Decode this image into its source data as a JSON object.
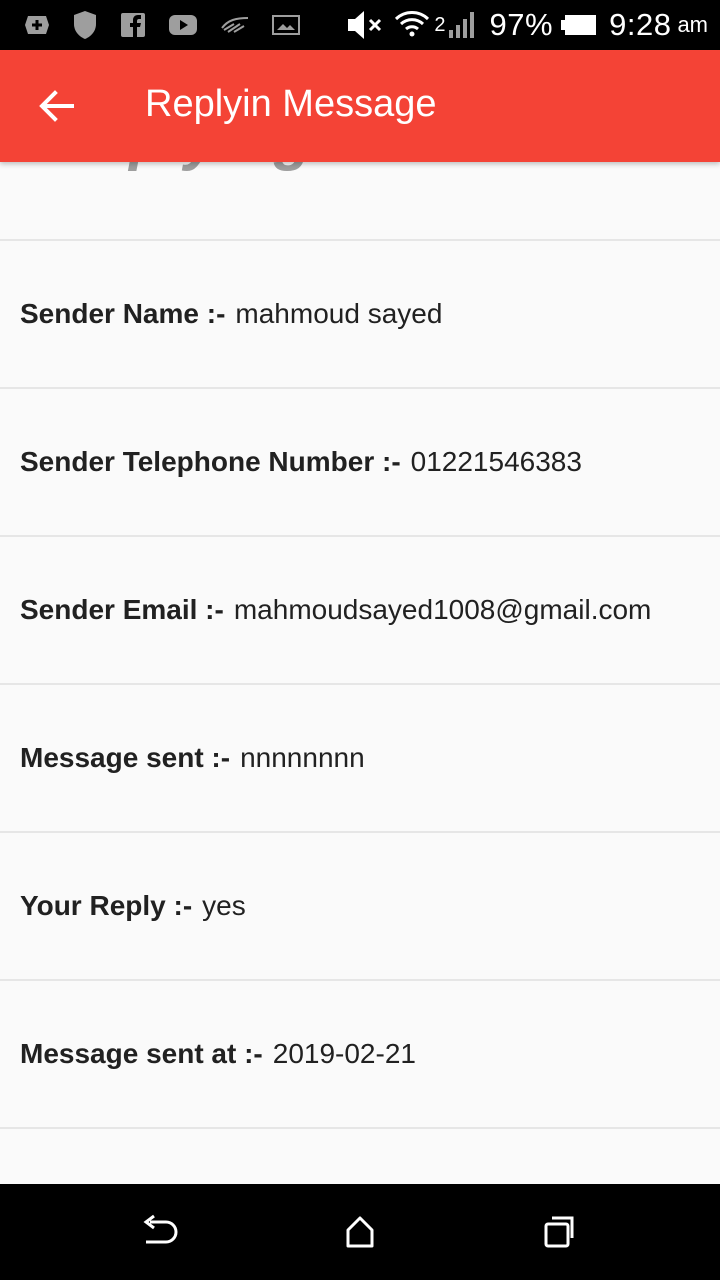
{
  "status_bar": {
    "battery": "97%",
    "time": "9:28",
    "ampm": "am",
    "sim_label": "2"
  },
  "app_bar": {
    "title": "Replyin Message",
    "background": "#f44336"
  },
  "heading": "Replying Information",
  "fields": [
    {
      "label": "Sender Name :-",
      "value": "mahmoud sayed"
    },
    {
      "label": "Sender Telephone Number :-",
      "value": "01221546383"
    },
    {
      "label": "Sender Email :-",
      "value": "mahmoudsayed1008@gmail.com"
    },
    {
      "label": "Message sent :-",
      "value": "nnnnnnnn"
    },
    {
      "label": "Your Reply :-",
      "value": "yes"
    },
    {
      "label": "Message sent at :-",
      "value": "2019-02-21"
    }
  ],
  "icons": {
    "back": "arrow-left-icon",
    "nav_back": "back-icon",
    "nav_home": "home-icon",
    "nav_recents": "recents-icon"
  }
}
